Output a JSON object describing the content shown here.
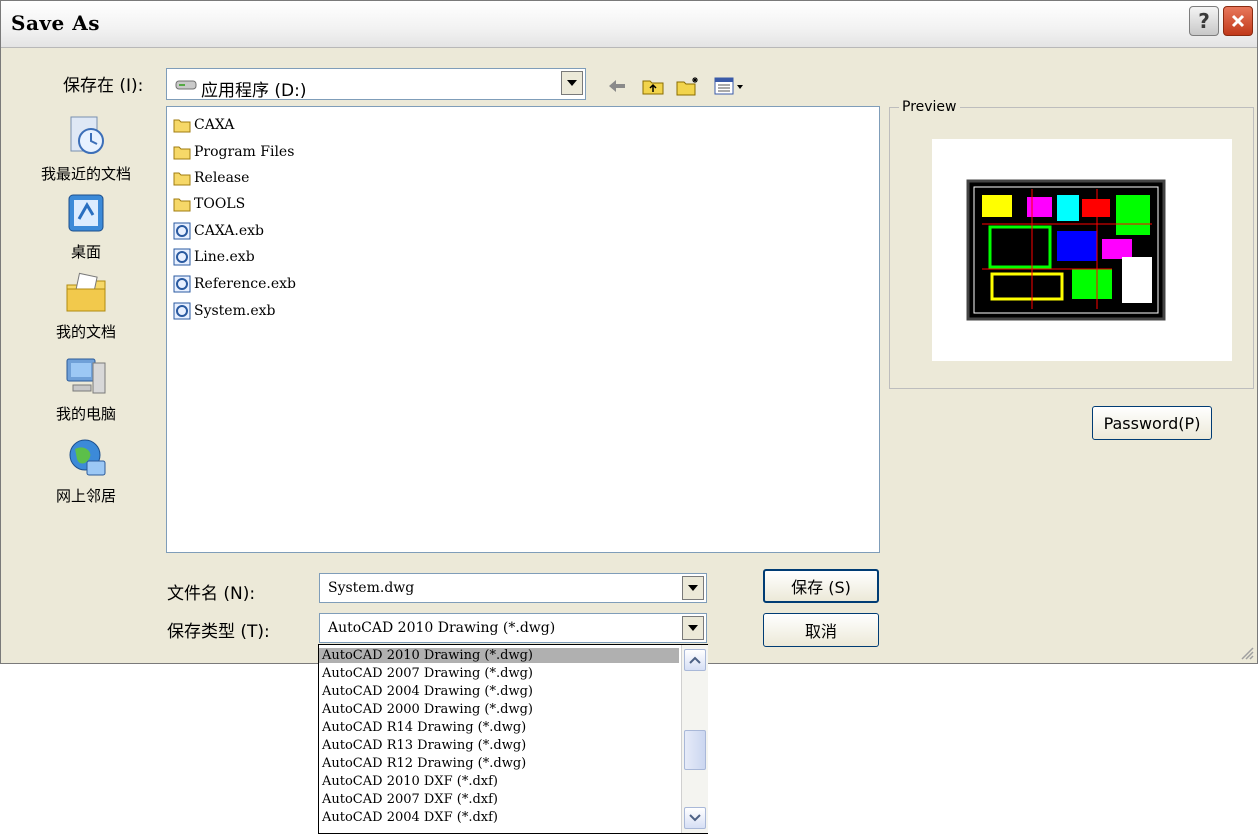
{
  "window": {
    "title": "Save As"
  },
  "look_in": {
    "label": "保存在 (I):",
    "value": "应用程序 (D:)"
  },
  "places": [
    {
      "label": "我最近的文档",
      "icon": "recent-documents-icon"
    },
    {
      "label": "桌面",
      "icon": "desktop-icon"
    },
    {
      "label": "我的文档",
      "icon": "my-documents-icon"
    },
    {
      "label": "我的电脑",
      "icon": "my-computer-icon"
    },
    {
      "label": "网上邻居",
      "icon": "network-places-icon"
    }
  ],
  "files": [
    {
      "name": "CAXA",
      "type": "folder"
    },
    {
      "name": "Program Files",
      "type": "folder"
    },
    {
      "name": "Release",
      "type": "folder"
    },
    {
      "name": "TOOLS",
      "type": "folder"
    },
    {
      "name": "CAXA.exb",
      "type": "exb"
    },
    {
      "name": "Line.exb",
      "type": "exb"
    },
    {
      "name": "Reference.exb",
      "type": "exb"
    },
    {
      "name": "System.exb",
      "type": "exb"
    }
  ],
  "preview": {
    "label": "Preview"
  },
  "password_button": "Password(P)",
  "filename": {
    "label": "文件名 (N):",
    "value": "System.dwg"
  },
  "filetype": {
    "label": "保存类型 (T):",
    "value": "AutoCAD 2010 Drawing (*.dwg)",
    "options": [
      "AutoCAD 2010 Drawing (*.dwg)",
      "AutoCAD 2007 Drawing (*.dwg)",
      "AutoCAD 2004 Drawing (*.dwg)",
      "AutoCAD 2000 Drawing (*.dwg)",
      "AutoCAD R14 Drawing (*.dwg)",
      "AutoCAD R13 Drawing (*.dwg)",
      "AutoCAD R12 Drawing (*.dwg)",
      "AutoCAD 2010 DXF (*.dxf)",
      "AutoCAD 2007 DXF (*.dxf)",
      "AutoCAD 2004 DXF (*.dxf)"
    ]
  },
  "buttons": {
    "save": "保存 (S)",
    "cancel": "取消"
  },
  "colors": {
    "title_close": "#c1391a",
    "selection": "#b0b0b0",
    "dialog_bg": "#ece9d8"
  }
}
